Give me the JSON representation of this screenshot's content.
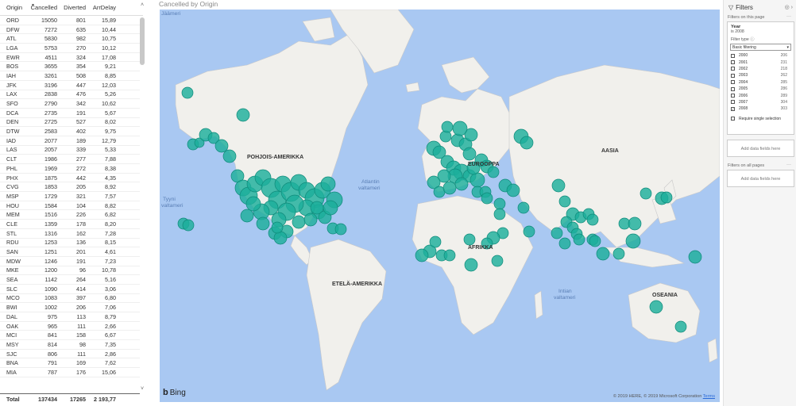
{
  "table": {
    "headers": [
      "Origin",
      "Cancelled",
      "Diverted",
      "ArrDelay"
    ],
    "rows": [
      [
        "ORD",
        "15050",
        "801",
        "15,89"
      ],
      [
        "DFW",
        "7272",
        "635",
        "10,44"
      ],
      [
        "ATL",
        "5830",
        "982",
        "10,75"
      ],
      [
        "LGA",
        "5753",
        "270",
        "10,12"
      ],
      [
        "EWR",
        "4511",
        "324",
        "17,08"
      ],
      [
        "BOS",
        "3655",
        "354",
        "9,21"
      ],
      [
        "IAH",
        "3261",
        "508",
        "8,85"
      ],
      [
        "JFK",
        "3196",
        "447",
        "12,03"
      ],
      [
        "LAX",
        "2838",
        "476",
        "5,26"
      ],
      [
        "SFO",
        "2790",
        "342",
        "10,62"
      ],
      [
        "DCA",
        "2735",
        "191",
        "5,67"
      ],
      [
        "DEN",
        "2725",
        "527",
        "8,02"
      ],
      [
        "DTW",
        "2583",
        "402",
        "9,75"
      ],
      [
        "IAD",
        "2077",
        "189",
        "12,79"
      ],
      [
        "LAS",
        "2057",
        "339",
        "5,33"
      ],
      [
        "CLT",
        "1986",
        "277",
        "7,88"
      ],
      [
        "PHL",
        "1969",
        "272",
        "8,38"
      ],
      [
        "PHX",
        "1875",
        "442",
        "4,35"
      ],
      [
        "CVG",
        "1853",
        "205",
        "8,92"
      ],
      [
        "MSP",
        "1729",
        "321",
        "7,57"
      ],
      [
        "HOU",
        "1584",
        "104",
        "8,82"
      ],
      [
        "MEM",
        "1516",
        "226",
        "6,82"
      ],
      [
        "CLE",
        "1359",
        "178",
        "8,20"
      ],
      [
        "STL",
        "1316",
        "162",
        "7,28"
      ],
      [
        "RDU",
        "1253",
        "136",
        "8,15"
      ],
      [
        "SAN",
        "1251",
        "201",
        "4,61"
      ],
      [
        "MDW",
        "1246",
        "191",
        "7,23"
      ],
      [
        "MKE",
        "1200",
        "96",
        "10,78"
      ],
      [
        "SEA",
        "1142",
        "264",
        "5,16"
      ],
      [
        "SLC",
        "1090",
        "414",
        "3,06"
      ],
      [
        "MCO",
        "1083",
        "397",
        "6,80"
      ],
      [
        "BWI",
        "1002",
        "206",
        "7,06"
      ],
      [
        "DAL",
        "975",
        "113",
        "8,79"
      ],
      [
        "OAK",
        "965",
        "111",
        "2,66"
      ],
      [
        "MCI",
        "841",
        "158",
        "6,67"
      ],
      [
        "MSY",
        "814",
        "98",
        "7,35"
      ],
      [
        "SJC",
        "806",
        "111",
        "2,86"
      ],
      [
        "BNA",
        "791",
        "169",
        "7,62"
      ],
      [
        "MIA",
        "787",
        "176",
        "15,06"
      ]
    ],
    "total": [
      "Total",
      "137434",
      "17265",
      "2 193,77"
    ]
  },
  "map": {
    "title": "Cancelled by Origin",
    "labels": {
      "na": "POHJOIS-AMERIKKA",
      "sa": "ETELÄ-AMERIKKA",
      "eu": "EUROOPPA",
      "af": "AFRIKKA",
      "as": "AASIA",
      "oc": "OSEANIA"
    },
    "seas": {
      "arctic": "Jäämeri",
      "pacific1": "Tyyni",
      "pacific2": "valtameri",
      "atlantic1": "Atlantin",
      "atlantic2": "valtameri",
      "indian1": "Intian",
      "indian2": "valtameri"
    },
    "bing": "Bing",
    "copyright": "© 2019 HERE, © 2019 Microsoft Corporation",
    "terms": "Terms",
    "bubble_color": "#1cae9b",
    "water_color": "#a9c8f2",
    "land_color": "#f1f0ec"
  },
  "filters": {
    "title": "Filters",
    "on_page": "Filters on this page",
    "card_title": "Year",
    "card_sub": "is 2008",
    "filter_type_label": "Filter type ⓘ",
    "filter_type_value": "Basic filtering",
    "years": [
      {
        "y": "2000",
        "c": "206"
      },
      {
        "y": "2001",
        "c": "231"
      },
      {
        "y": "2002",
        "c": "218"
      },
      {
        "y": "2003",
        "c": "262"
      },
      {
        "y": "2004",
        "c": "285"
      },
      {
        "y": "2005",
        "c": "286"
      },
      {
        "y": "2006",
        "c": "289"
      },
      {
        "y": "2007",
        "c": "304"
      },
      {
        "y": "2008",
        "c": "303",
        "checked": true
      }
    ],
    "require_single": "Require single selection",
    "add_data": "Add data fields here",
    "on_all": "Filters on all pages",
    "add_data2": "Add data fields here"
  }
}
